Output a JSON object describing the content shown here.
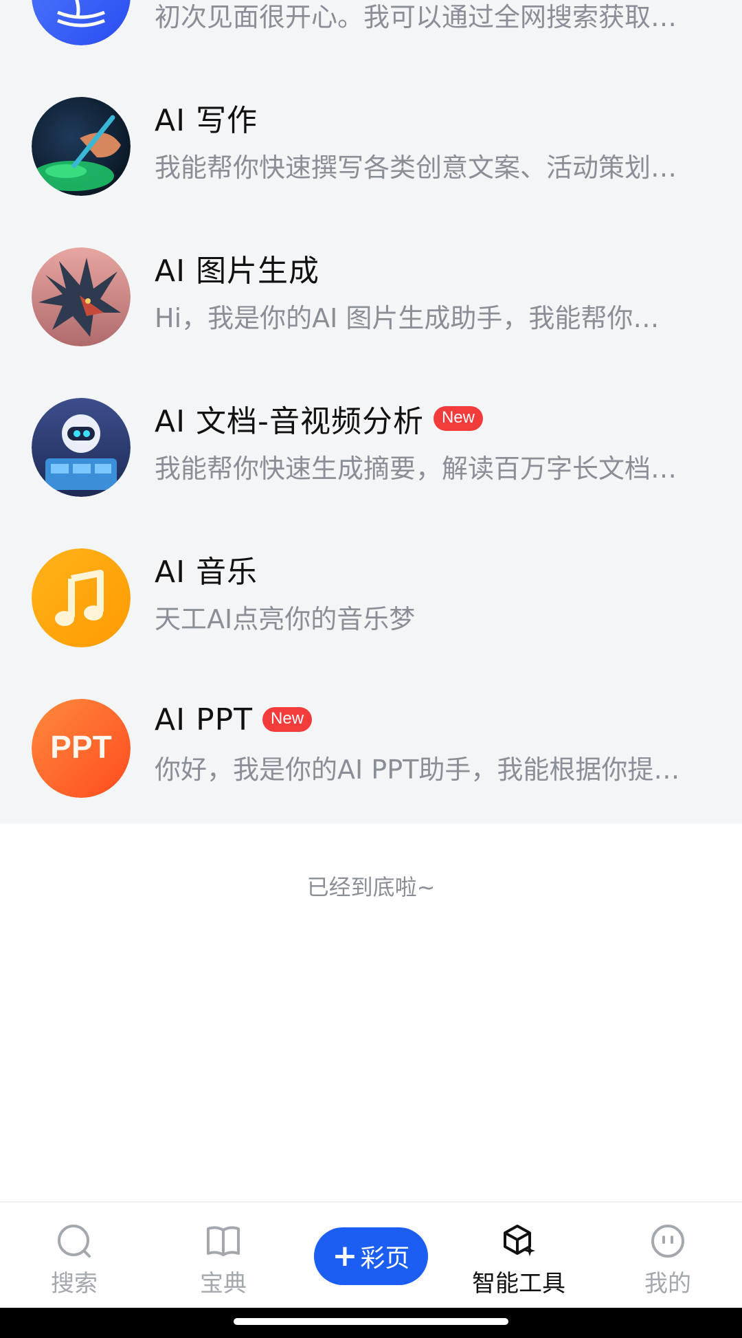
{
  "list": {
    "items": [
      {
        "title": "",
        "desc": "初次见面很开心。我可以通过全网搜索获取…",
        "badge": "",
        "icon": "tiangong-search-icon"
      },
      {
        "title": "AI 写作",
        "desc": "我能帮你快速撰写各类创意文案、活动策划…",
        "badge": "",
        "icon": "ai-writing-icon"
      },
      {
        "title": "AI 图片生成",
        "desc": "Hi，我是你的AI 图片生成助手，我能帮你…",
        "badge": "",
        "icon": "ai-image-dragon-icon"
      },
      {
        "title": "AI 文档-音视频分析",
        "desc": "我能帮你快速生成摘要，解读百万字长文档…",
        "badge": "New",
        "icon": "ai-doc-robot-icon"
      },
      {
        "title": "AI 音乐",
        "desc": "天工AI点亮你的音乐梦",
        "badge": "",
        "icon": "music-note-icon"
      },
      {
        "title": "AI PPT",
        "desc": "你好，我是你的AI PPT助手，我能根据你提…",
        "badge": "New",
        "icon": "ppt-icon"
      }
    ],
    "ppt_icon_text": "PPT"
  },
  "end_text": "已经到底啦~",
  "tabbar": {
    "search": "搜索",
    "guide": "宝典",
    "center": "彩页",
    "center_plus": "+",
    "tools": "智能工具",
    "mine": "我的",
    "active": "tools"
  },
  "colors": {
    "accent": "#1d5ef2",
    "badge": "#f23b3b",
    "list_bg": "#f4f5f7",
    "muted_text": "#8a8e96"
  }
}
